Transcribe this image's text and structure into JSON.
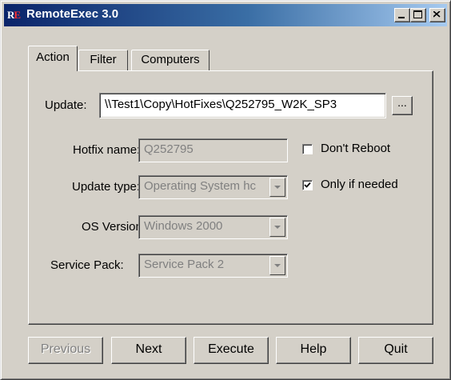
{
  "window": {
    "title": "RemoteExec 3.0",
    "icon_text": "RE"
  },
  "tabs": [
    {
      "label": "Action",
      "selected": true
    },
    {
      "label": "Filter",
      "selected": false
    },
    {
      "label": "Computers",
      "selected": false
    }
  ],
  "form": {
    "update_label": "Update:",
    "update_value": "\\\\Test1\\Copy\\HotFixes\\Q252795_W2K_SP3",
    "browse_label": "...",
    "hotfix_label": "Hotfix name:",
    "hotfix_value": "Q252795",
    "update_type_label": "Update type:",
    "update_type_value": "Operating System hc",
    "os_version_label": "OS Version:",
    "os_version_value": "Windows 2000",
    "service_pack_label": "Service Pack:",
    "service_pack_value": "Service Pack 2",
    "dont_reboot_label": "Don't Reboot",
    "dont_reboot_checked": false,
    "only_if_needed_label": "Only if needed",
    "only_if_needed_checked": true
  },
  "buttons": {
    "previous": "Previous",
    "next": "Next",
    "execute": "Execute",
    "help": "Help",
    "quit": "Quit"
  },
  "icons": {
    "minimize": "minimize-icon",
    "maximize": "maximize-icon",
    "close": "close-icon",
    "dropdown": "chevron-down-icon",
    "check": "check-icon"
  }
}
